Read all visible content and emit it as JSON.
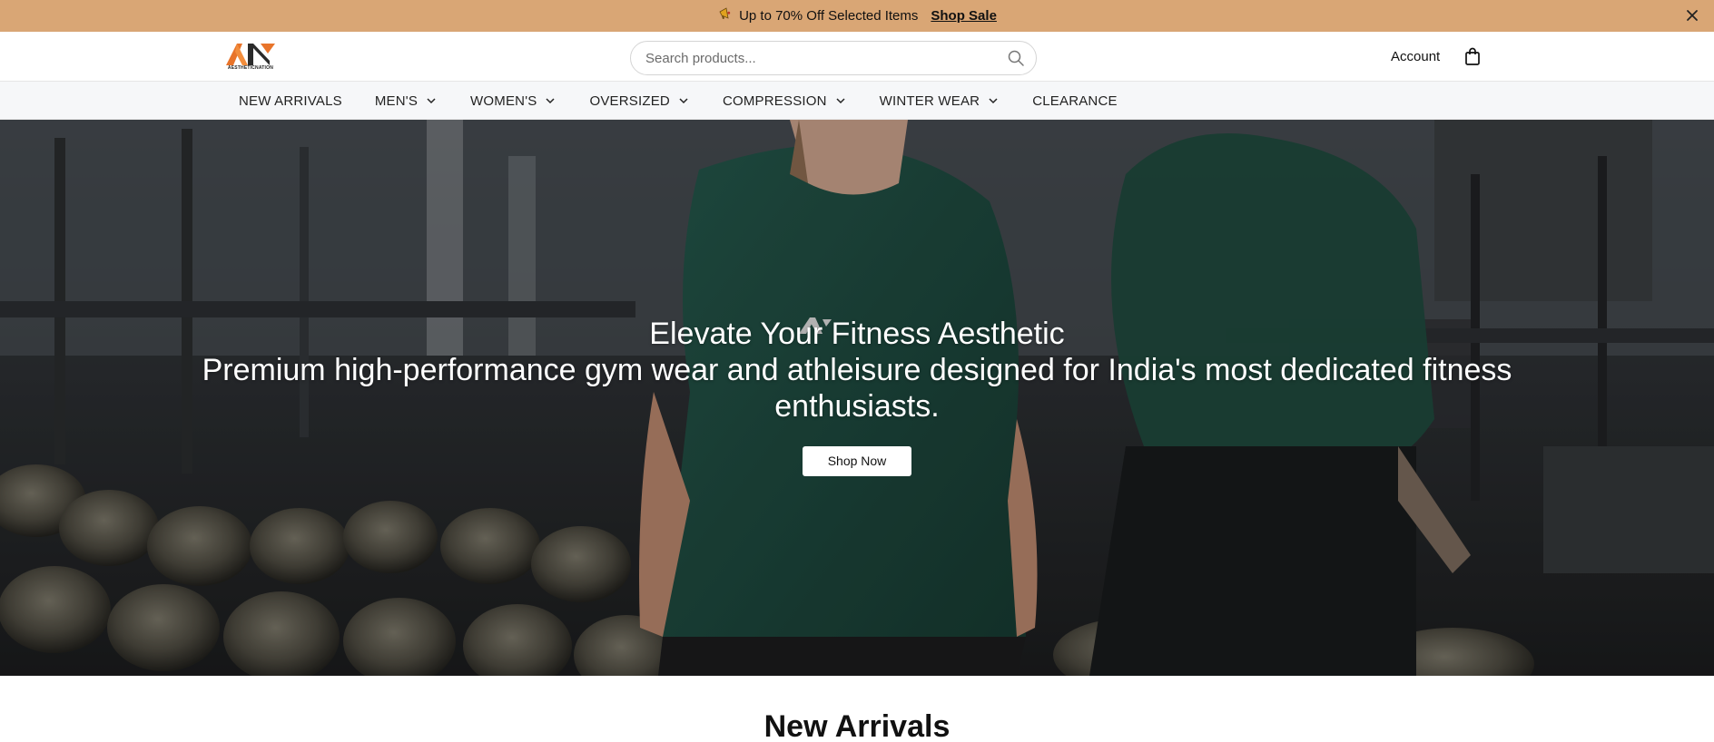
{
  "announcement": {
    "emoji_icon": "megaphone-icon",
    "text": "Up to 70% Off Selected Items",
    "link_label": "Shop Sale"
  },
  "header": {
    "logo_text": "AESTHETICNATION",
    "search_placeholder": "Search products...",
    "account_label": "Account"
  },
  "nav": {
    "items": [
      {
        "label": "NEW ARRIVALS",
        "dropdown": false
      },
      {
        "label": "MEN'S",
        "dropdown": true
      },
      {
        "label": "WOMEN'S",
        "dropdown": true
      },
      {
        "label": "OVERSIZED",
        "dropdown": true
      },
      {
        "label": "COMPRESSION",
        "dropdown": true
      },
      {
        "label": "WINTER WEAR",
        "dropdown": true
      },
      {
        "label": "CLEARANCE",
        "dropdown": false
      }
    ]
  },
  "hero": {
    "title": "Elevate Your Fitness Aesthetic",
    "subtitle": "Premium high-performance gym wear and athleisure designed for India's most dedicated fitness enthusiasts.",
    "cta_label": "Shop Now"
  },
  "sections": {
    "new_arrivals_title": "New Arrivals"
  },
  "colors": {
    "announcement_bg": "#d9a675",
    "nav_bg": "#f6f7f9",
    "logo_orange": "#e8742a",
    "logo_dark": "#2b2b2b",
    "shirt_green": "#1f4a3d"
  }
}
